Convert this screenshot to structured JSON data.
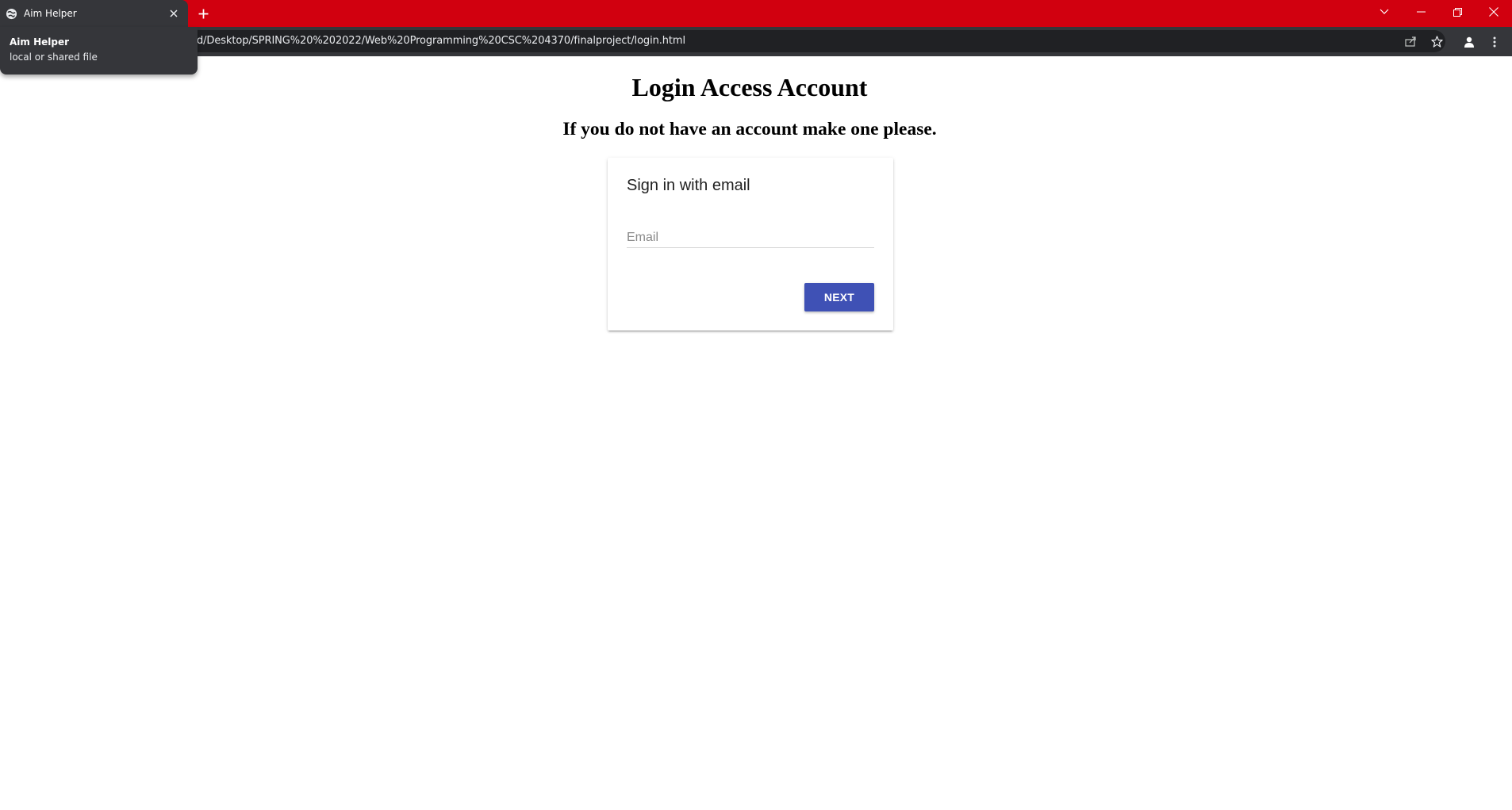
{
  "browser": {
    "tab": {
      "title": "Aim Helper",
      "favicon": "globe-icon",
      "close_icon": "close-icon"
    },
    "new_tab_icon": "plus-icon",
    "window_controls": [
      "tab-search-icon",
      "minimize-icon",
      "restore-icon",
      "close-window-icon"
    ],
    "address_bar": {
      "url": "d/Desktop/SPRING%20%202022/Web%20Programming%20CSC%204370/finalproject/login.html",
      "icons": [
        "share-icon",
        "bookmark-star-icon"
      ]
    },
    "toolbar_icons": [
      "profile-icon",
      "kebab-menu-icon"
    ],
    "tooltip": {
      "title": "Aim Helper",
      "subtitle": "local or shared file"
    },
    "colors": {
      "tabstrip": "#d1000f",
      "toolbar": "#35363a",
      "omnibox": "#202124"
    }
  },
  "page": {
    "title": "Login Access Account",
    "subtitle": "If you do not have an account make one please.",
    "signin_card": {
      "heading": "Sign in with email",
      "email_placeholder": "Email",
      "email_value": "",
      "next_label": "NEXT",
      "accent_color": "#3f51b5"
    }
  }
}
